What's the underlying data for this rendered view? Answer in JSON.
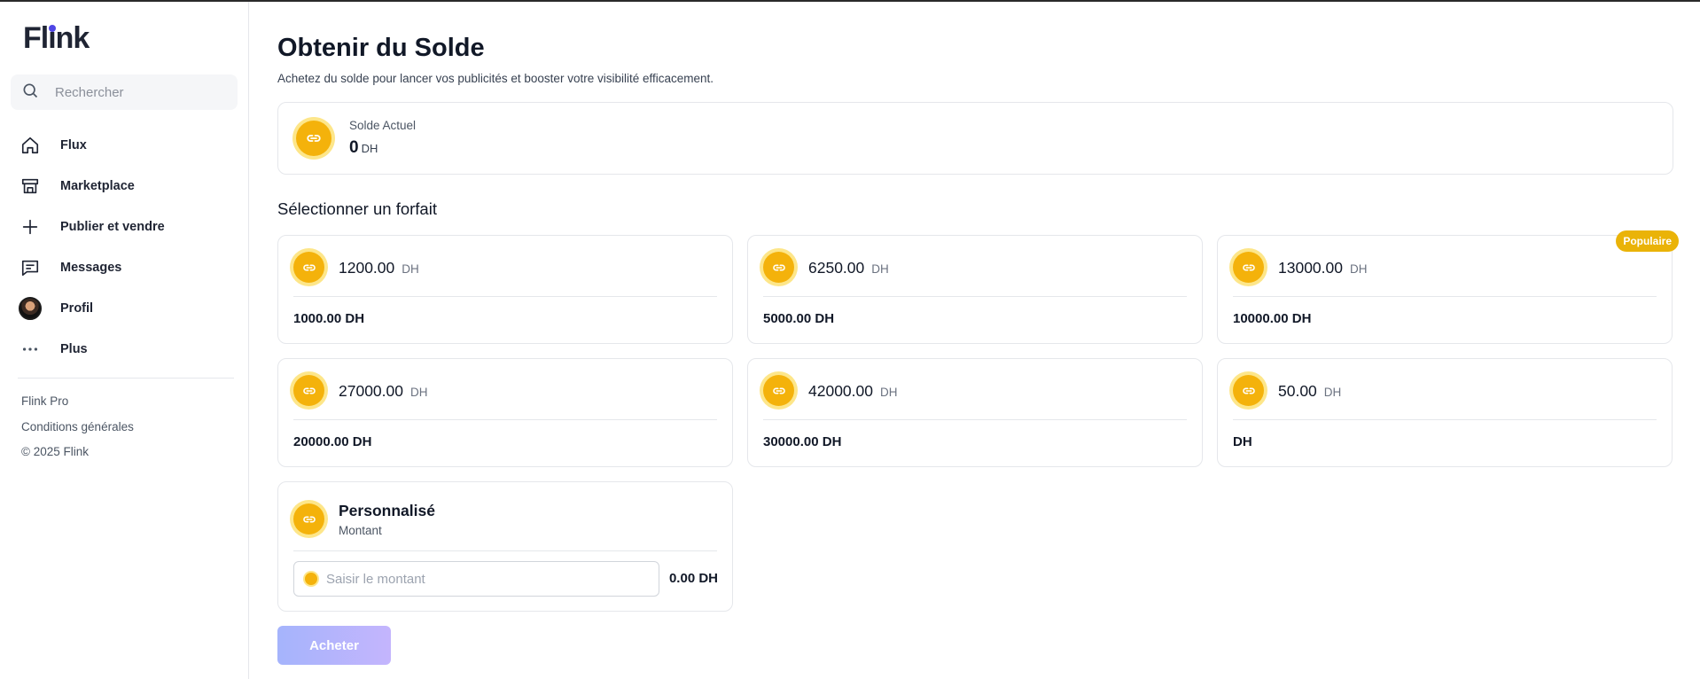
{
  "app": {
    "logo": "Flink"
  },
  "sidebar": {
    "search_placeholder": "Rechercher",
    "items": [
      {
        "label": "Flux",
        "icon": "home-icon"
      },
      {
        "label": "Marketplace",
        "icon": "store-icon"
      },
      {
        "label": "Publier et vendre",
        "icon": "plus-icon"
      },
      {
        "label": "Messages",
        "icon": "message-icon"
      },
      {
        "label": "Profil",
        "icon": "avatar"
      },
      {
        "label": "Plus",
        "icon": "more-dots-icon"
      }
    ],
    "footer": {
      "pro": "Flink Pro",
      "terms": "Conditions générales",
      "copyright": "© 2025 Flink"
    }
  },
  "main": {
    "title": "Obtenir du Solde",
    "subtitle": "Achetez du solde pour lancer vos publicités et booster votre visibilité efficacement.",
    "balance": {
      "label": "Solde Actuel",
      "value": "0",
      "unit": "DH"
    },
    "section_title": "Sélectionner un forfait",
    "plans": [
      {
        "price": "1200.00",
        "unit": "DH",
        "amount": "1000.00 DH",
        "badge": ""
      },
      {
        "price": "6250.00",
        "unit": "DH",
        "amount": "5000.00 DH",
        "badge": ""
      },
      {
        "price": "13000.00",
        "unit": "DH",
        "amount": "10000.00 DH",
        "badge": "Populaire"
      },
      {
        "price": "27000.00",
        "unit": "DH",
        "amount": "20000.00 DH",
        "badge": ""
      },
      {
        "price": "42000.00",
        "unit": "DH",
        "amount": "30000.00 DH",
        "badge": ""
      },
      {
        "price": "50.00",
        "unit": "DH",
        "amount": "DH",
        "badge": ""
      }
    ],
    "custom": {
      "title": "Personnalisé",
      "subtitle": "Montant",
      "placeholder": "Saisir le montant",
      "value": "",
      "total": "0.00 DH"
    },
    "buy_label": "Acheter"
  },
  "colors": {
    "coin": "#f4b20b",
    "badge": "#eab308",
    "button_gradient_start": "#a5b4fc",
    "button_gradient_end": "#c4b5fd"
  }
}
